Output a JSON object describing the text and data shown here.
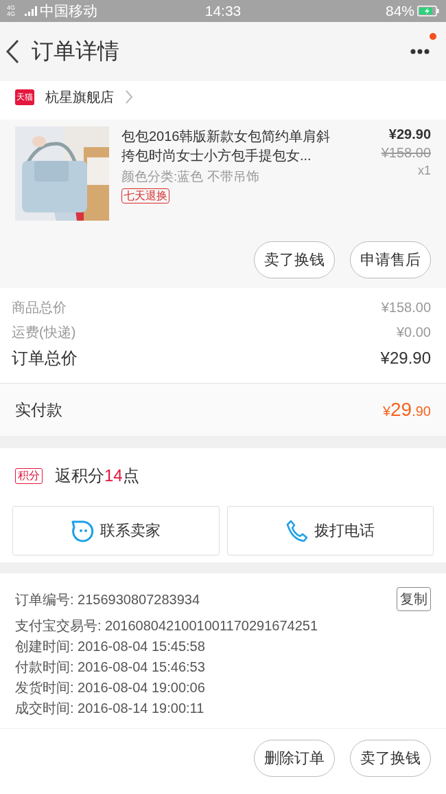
{
  "status_bar": {
    "network": "4G 4G",
    "carrier": "中国移动",
    "time": "14:33",
    "battery": "84%",
    "charging": true
  },
  "nav": {
    "title": "订单详情",
    "notification": true
  },
  "shop": {
    "badge": "天猫",
    "name": "杭星旗舰店"
  },
  "product": {
    "title": "包包2016韩版新款女包简约单肩斜挎包时尚女士小方包手提包女...",
    "spec": "颜色分类:蓝色 不带吊饰",
    "tag": "七天退换",
    "price": "¥29.90",
    "original_price": "¥158.00",
    "quantity": "x1"
  },
  "product_buttons": [
    "卖了换钱",
    "申请售后"
  ],
  "summary": [
    {
      "kind": "minor",
      "label": "商品总价",
      "value": "¥158.00"
    },
    {
      "kind": "minor",
      "label": "运费(快递)",
      "value": "¥0.00"
    },
    {
      "kind": "total",
      "label": "订单总价",
      "value": "¥29.90"
    }
  ],
  "payment": {
    "label": "实付款",
    "currency": "¥",
    "integer": "29",
    "decimal": ".90"
  },
  "points": {
    "badge": "积分",
    "prefix": "返积分",
    "value": "14",
    "suffix": "点"
  },
  "contact_buttons": [
    {
      "kind": "chat",
      "label": "联系卖家"
    },
    {
      "kind": "phone",
      "label": "拨打电话"
    }
  ],
  "order_info": [
    {
      "label": "订单编号:",
      "value": "2156930807283934"
    },
    {
      "label": "支付宝交易号:",
      "value": "2016080421001001170291674251"
    },
    {
      "label": "创建时间:",
      "value": "2016-08-04 15:45:58"
    },
    {
      "label": "付款时间:",
      "value": "2016-08-04 15:46:53"
    },
    {
      "label": "发货时间:",
      "value": "2016-08-04 19:00:06"
    },
    {
      "label": "成交时间:",
      "value": "2016-08-14 19:00:11"
    }
  ],
  "copy_button": "复制",
  "bottom_buttons": [
    "删除订单",
    "卖了换钱"
  ]
}
